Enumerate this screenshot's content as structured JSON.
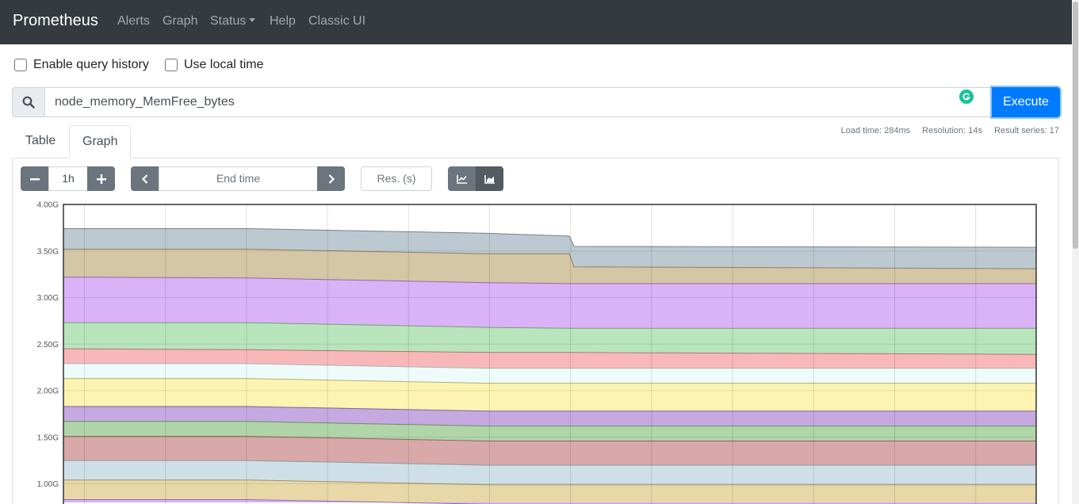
{
  "navbar": {
    "brand": "Prometheus",
    "links": [
      "Alerts",
      "Graph",
      "Status",
      "Help",
      "Classic UI"
    ]
  },
  "options": {
    "query_history_label": "Enable query history",
    "local_time_label": "Use local time"
  },
  "query": {
    "value": "node_memory_MemFree_bytes",
    "execute_label": "Execute"
  },
  "stats": {
    "load_time": "Load time: 284ms",
    "resolution": "Resolution: 14s",
    "result_series": "Result series: 17"
  },
  "tabs": [
    "Table",
    "Graph"
  ],
  "active_tab": "Graph",
  "controls": {
    "range_value": "1h",
    "end_time_placeholder": "End time",
    "res_placeholder": "Res. (s)"
  },
  "chart_data": {
    "type": "area",
    "stacked": true,
    "y_tick_labels": [
      "4.00G",
      "3.50G",
      "3.00G",
      "2.50G",
      "2.00G",
      "1.50G",
      "1.00G"
    ],
    "y_ticks": [
      4.0,
      3.5,
      3.0,
      2.5,
      2.0,
      1.5,
      1.0
    ],
    "ylim": [
      0.8,
      4.0
    ],
    "x_points": [
      0,
      0.19,
      0.436,
      0.52,
      0.525,
      1
    ],
    "boundaries": [
      [
        3.74,
        3.74,
        3.69,
        3.66,
        3.55,
        3.54
      ],
      [
        3.52,
        3.52,
        3.47,
        3.47,
        3.33,
        3.31
      ],
      [
        3.22,
        3.21,
        3.16,
        3.15,
        3.15,
        3.15
      ],
      [
        2.73,
        2.73,
        2.68,
        2.67,
        2.67,
        2.67
      ],
      [
        2.45,
        2.44,
        2.41,
        2.41,
        2.41,
        2.39
      ],
      [
        2.29,
        2.29,
        2.24,
        2.24,
        2.24,
        2.24
      ],
      [
        2.13,
        2.13,
        2.08,
        2.08,
        2.08,
        2.08
      ],
      [
        1.83,
        1.83,
        1.78,
        1.78,
        1.78,
        1.78
      ],
      [
        1.67,
        1.67,
        1.62,
        1.62,
        1.62,
        1.62
      ],
      [
        1.51,
        1.51,
        1.46,
        1.46,
        1.46,
        1.46
      ],
      [
        1.25,
        1.25,
        1.2,
        1.2,
        1.2,
        1.2
      ],
      [
        1.04,
        1.04,
        0.99,
        0.99,
        0.99,
        0.99
      ],
      [
        0.83,
        0.83,
        0.78,
        0.78,
        0.78,
        0.78
      ]
    ],
    "colors": [
      "#bdc9d1",
      "#d3c7a5",
      "#dab2f7",
      "#b9e5bc",
      "#f8b8ba",
      "#edfcfa",
      "#fdf3b2",
      "#c6a9e0",
      "#b0d5a8",
      "#d9a9a9",
      "#cfdfe8",
      "#e8d8a8",
      "#dab2f7"
    ],
    "stroke_colors": [
      "#77838b",
      "#8d815f",
      "#9468b1",
      "#739f76",
      "#b27274",
      "#a7b6b4",
      "#b7ad6c",
      "#80639a",
      "#6a8f62",
      "#936363",
      "#8999a2",
      "#a29262",
      "#9468b1"
    ],
    "grid": true
  }
}
